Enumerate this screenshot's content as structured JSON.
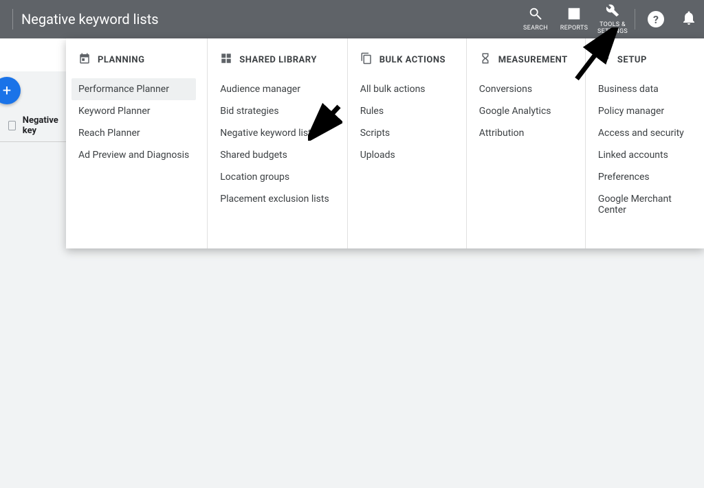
{
  "header": {
    "title": "Negative keyword lists",
    "icons": {
      "search": "SEARCH",
      "reports": "REPORTS",
      "tools": "TOOLS & SETTINGS"
    }
  },
  "fab_label": "+",
  "row_title_truncated": "Negative key",
  "menu": {
    "planning": {
      "title": "PLANNING",
      "items": [
        "Performance Planner",
        "Keyword Planner",
        "Reach Planner",
        "Ad Preview and Diagnosis"
      ]
    },
    "shared_library": {
      "title": "SHARED LIBRARY",
      "items": [
        "Audience manager",
        "Bid strategies",
        "Negative keyword lists",
        "Shared budgets",
        "Location groups",
        "Placement exclusion lists"
      ]
    },
    "bulk_actions": {
      "title": "BULK ACTIONS",
      "items": [
        "All bulk actions",
        "Rules",
        "Scripts",
        "Uploads"
      ]
    },
    "measurement": {
      "title": "MEASUREMENT",
      "items": [
        "Conversions",
        "Google Analytics",
        "Attribution"
      ]
    },
    "setup": {
      "title": "SETUP",
      "items": [
        "Business data",
        "Policy manager",
        "Access and security",
        "Linked accounts",
        "Preferences",
        "Google Merchant Center"
      ]
    }
  }
}
